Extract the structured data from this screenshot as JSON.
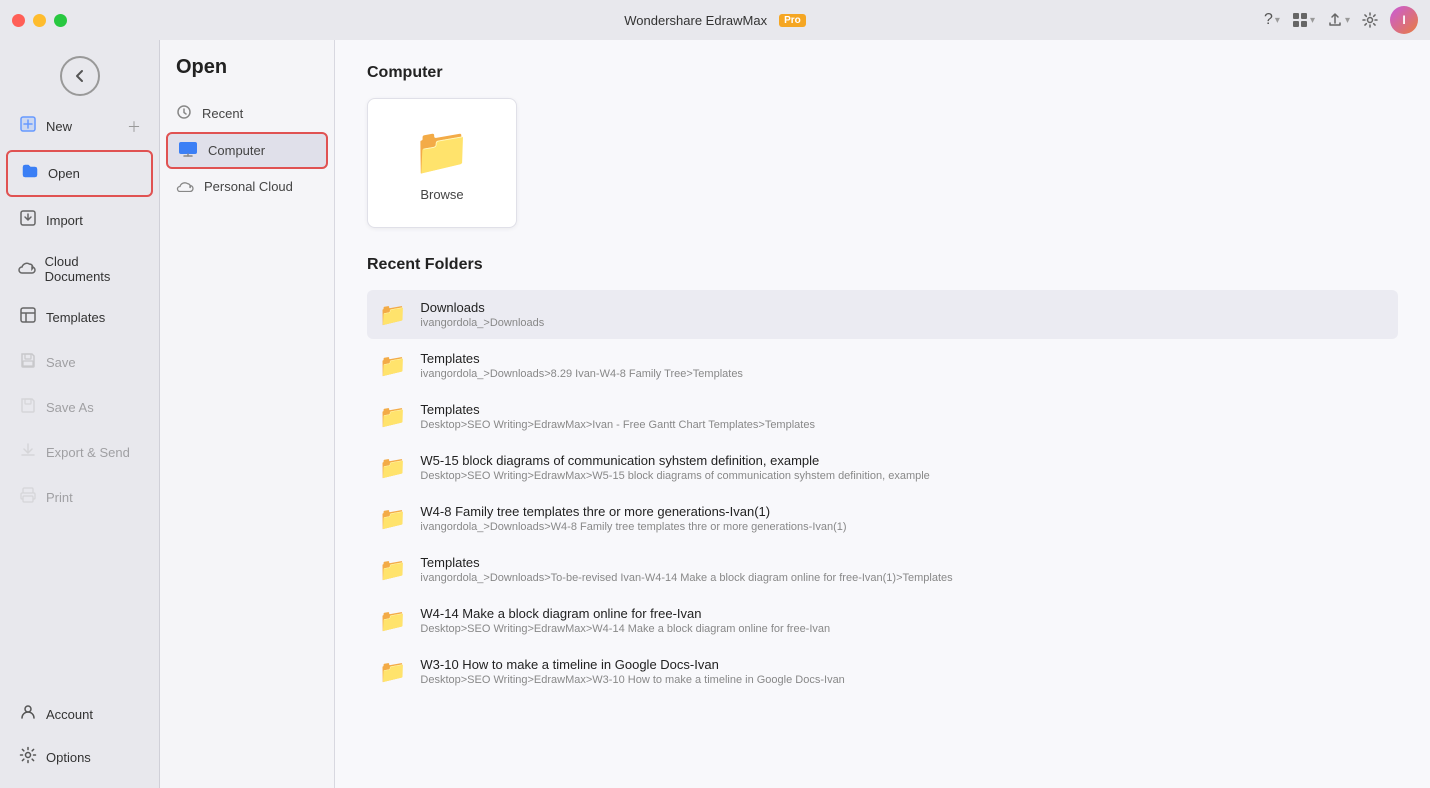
{
  "app": {
    "title": "Wondershare EdrawMax",
    "pro_label": "Pro"
  },
  "titlebar": {
    "traffic": [
      "close",
      "minimize",
      "maximize"
    ],
    "help_icon": "?",
    "apps_icon": "⊞",
    "share_icon": "↑",
    "settings_icon": "⚙"
  },
  "sidebar": {
    "back_label": "←",
    "items": [
      {
        "id": "new",
        "label": "New",
        "icon": "➕",
        "active": false,
        "highlighted": false
      },
      {
        "id": "open",
        "label": "Open",
        "icon": "📂",
        "active": true,
        "highlighted": true
      },
      {
        "id": "import",
        "label": "Import",
        "icon": "📥",
        "active": false
      },
      {
        "id": "cloud-documents",
        "label": "Cloud Documents",
        "icon": "☁️",
        "active": false
      },
      {
        "id": "templates",
        "label": "Templates",
        "icon": "🗂",
        "active": false
      },
      {
        "id": "save",
        "label": "Save",
        "icon": "💾",
        "active": false,
        "disabled": true
      },
      {
        "id": "save-as",
        "label": "Save As",
        "icon": "💾",
        "active": false,
        "disabled": true
      },
      {
        "id": "export-send",
        "label": "Export & Send",
        "icon": "📤",
        "active": false,
        "disabled": true
      },
      {
        "id": "print",
        "label": "Print",
        "icon": "🖨",
        "active": false,
        "disabled": true
      }
    ],
    "bottom_items": [
      {
        "id": "account",
        "label": "Account",
        "icon": "👤"
      },
      {
        "id": "options",
        "label": "Options",
        "icon": "⚙️"
      }
    ]
  },
  "open_panel": {
    "title": "Open",
    "items": [
      {
        "id": "recent",
        "label": "Recent",
        "icon": "clock"
      },
      {
        "id": "computer",
        "label": "Computer",
        "icon": "computer",
        "active": true
      },
      {
        "id": "personal-cloud",
        "label": "Personal Cloud",
        "icon": "cloud"
      }
    ]
  },
  "main": {
    "computer_section_title": "Computer",
    "browse_label": "Browse",
    "recent_folders_title": "Recent Folders",
    "folders": [
      {
        "name": "Downloads",
        "path": "ivangordola_>Downloads"
      },
      {
        "name": "Templates",
        "path": "ivangordola_>Downloads>8.29 Ivan-W4-8 Family Tree>Templates"
      },
      {
        "name": "Templates",
        "path": "Desktop>SEO Writing>EdrawMax>Ivan - Free Gantt Chart Templates>Templates"
      },
      {
        "name": "W5-15 block diagrams of communication syhstem definition, example",
        "path": "Desktop>SEO Writing>EdrawMax>W5-15 block diagrams of communication syhstem definition, example"
      },
      {
        "name": "W4-8 Family tree templates thre or more generations-Ivan(1)",
        "path": "ivangordola_>Downloads>W4-8 Family tree templates thre or more generations-Ivan(1)"
      },
      {
        "name": "Templates",
        "path": "ivangordola_>Downloads>To-be-revised Ivan-W4-14 Make a block diagram online for free-Ivan(1)>Templates"
      },
      {
        "name": "W4-14 Make a block diagram online for free-Ivan",
        "path": "Desktop>SEO Writing>EdrawMax>W4-14 Make a block diagram online for free-Ivan"
      },
      {
        "name": "W3-10 How to make a timeline in Google Docs-Ivan",
        "path": "Desktop>SEO Writing>EdrawMax>W3-10 How to make a timeline in Google Docs-Ivan"
      }
    ]
  }
}
